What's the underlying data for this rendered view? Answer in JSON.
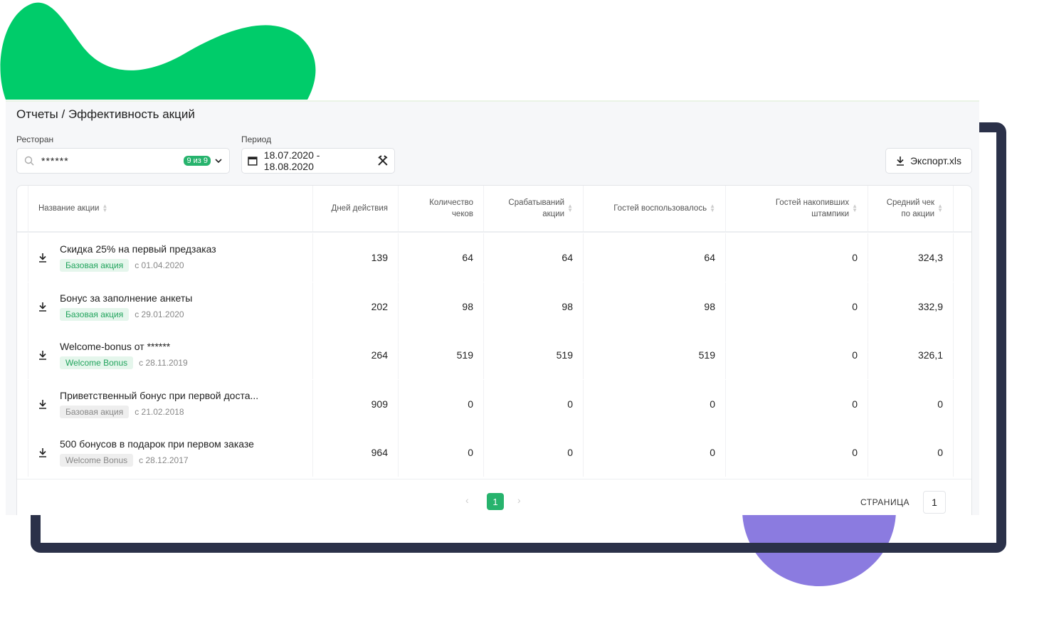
{
  "colors": {
    "accent": "#27b36d",
    "blob_green": "#00cc6a",
    "blob_purple": "#8b7be0",
    "frame": "#2b3149"
  },
  "header": {
    "title": "Отчеты / Эффективность акций"
  },
  "filters": {
    "restaurant_label": "Ресторан",
    "restaurant_value": "******",
    "restaurant_badge": "9 из 9",
    "period_label": "Период",
    "period_value": "18.07.2020 - 18.08.2020"
  },
  "export_label": "Экспорт.xls",
  "table": {
    "columns": [
      "Название акции",
      "Дней действия",
      "Количество чеков",
      "Срабатываний акции",
      "Гостей воспользовалось",
      "Гостей накопивших штампики",
      "Средний чек по акции"
    ],
    "rows": [
      {
        "name": "Скидка 25% на первый предзаказ",
        "tag": "Базовая акция",
        "tag_active": true,
        "since": "с 01.04.2020",
        "values": [
          "139",
          "64",
          "64",
          "64",
          "0",
          "324,3"
        ]
      },
      {
        "name": "Бонус за заполнение анкеты",
        "tag": "Базовая акция",
        "tag_active": true,
        "since": "с 29.01.2020",
        "values": [
          "202",
          "98",
          "98",
          "98",
          "0",
          "332,9"
        ]
      },
      {
        "name": "Welcome-bonus от ******",
        "tag": "Welcome Bonus",
        "tag_active": true,
        "since": "с 28.11.2019",
        "values": [
          "264",
          "519",
          "519",
          "519",
          "0",
          "326,1"
        ]
      },
      {
        "name": "Приветственный бонус при первой доста...",
        "tag": "Базовая акция",
        "tag_active": false,
        "since": "с 21.02.2018",
        "values": [
          "909",
          "0",
          "0",
          "0",
          "0",
          "0"
        ]
      },
      {
        "name": "500 бонусов в подарок при первом заказе",
        "tag": "Welcome Bonus",
        "tag_active": false,
        "since": "с 28.12.2017",
        "values": [
          "964",
          "0",
          "0",
          "0",
          "0",
          "0"
        ]
      }
    ]
  },
  "pagination": {
    "current": "1",
    "page_label": "СТРАНИЦА",
    "page_input": "1"
  }
}
